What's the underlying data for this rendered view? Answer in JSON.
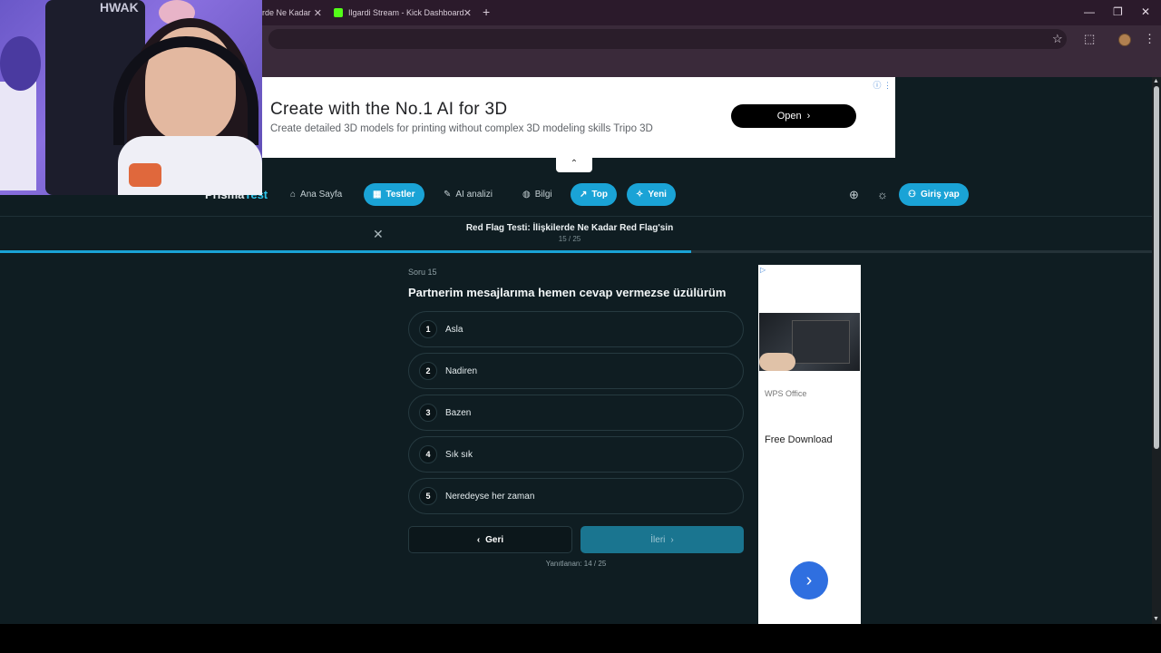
{
  "browser": {
    "tabs": [
      {
        "title": "rde Ne Kadar",
        "close": "✕"
      },
      {
        "title": "Ilgardi Stream - Kick Dashboard",
        "close": "✕"
      }
    ],
    "new_tab": "+",
    "window": {
      "minimize": "—",
      "restore": "❐",
      "close": "✕"
    },
    "toolbar_icons": {
      "bookmark": "☆",
      "extensions": "⬚",
      "menu": "⋮"
    }
  },
  "webcam": {
    "chair_text": "HWAK"
  },
  "top_ad": {
    "headline": "Create with the No.1 AI for 3D",
    "sub": "Create detailed 3D models for printing without complex 3D modeling skills Tripo 3D",
    "button": "Open",
    "button_icon": "›",
    "collapse": "⌃"
  },
  "site": {
    "logo_main": "Prisma",
    "logo_accent": "Test",
    "nav": [
      {
        "label": "Ana Sayfa",
        "icon": "⌂"
      },
      {
        "label": "Testler",
        "icon": "▦"
      },
      {
        "label": "AI analizi",
        "icon": "✎"
      },
      {
        "label": "Bilgi",
        "icon": "◍"
      },
      {
        "label": "Top",
        "icon": "↗"
      },
      {
        "label": "Yeni",
        "icon": "✧"
      }
    ],
    "globe": "⊕",
    "theme": "☼",
    "login": "Giriş yap",
    "login_icon": "⚇"
  },
  "quiz": {
    "close": "✕",
    "title": "Red Flag Testi: İlişkilerde Ne Kadar Red Flag'sin",
    "count": "15 / 25",
    "progress": 0.6,
    "question_label": "Soru 15",
    "question": "Partnerim mesajlarıma hemen cevap vermezse üzülürüm",
    "options": [
      {
        "num": "1",
        "label": "Asla"
      },
      {
        "num": "2",
        "label": "Nadiren"
      },
      {
        "num": "3",
        "label": "Bazen"
      },
      {
        "num": "4",
        "label": "Sık sık"
      },
      {
        "num": "5",
        "label": "Neredeyse her zaman"
      }
    ],
    "back": "Geri",
    "back_icon": "‹",
    "next": "İleri",
    "next_icon": "›",
    "answered": "Yanıtlanan: 14 / 25"
  },
  "side_ad": {
    "adtag": "▷",
    "brand": "WPS Office",
    "cta": "Free Download",
    "go": "›"
  }
}
